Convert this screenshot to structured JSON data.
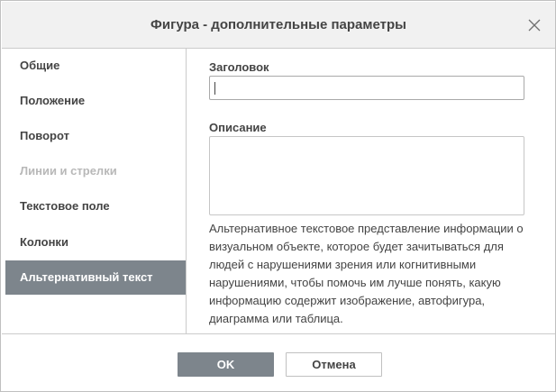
{
  "dialog": {
    "title": "Фигура - дополнительные параметры",
    "close_icon": "close-icon"
  },
  "sidebar": {
    "items": [
      {
        "label": "Общие",
        "state": "normal"
      },
      {
        "label": "Положение",
        "state": "normal"
      },
      {
        "label": "Поворот",
        "state": "normal"
      },
      {
        "label": "Линии и стрелки",
        "state": "disabled"
      },
      {
        "label": "Текстовое поле",
        "state": "normal"
      },
      {
        "label": "Колонки",
        "state": "normal"
      },
      {
        "label": "Альтернативный текст",
        "state": "active"
      }
    ]
  },
  "alt_text": {
    "title_label": "Заголовок",
    "title_value": "",
    "description_label": "Описание",
    "description_value": "",
    "help_text": "Альтернативное текстовое представление информации о визуальном объекте, которое будет зачитываться для людей с нарушениями зрения или когнитивными нарушениями, чтобы помочь им лучше понять, какую информацию содержит изображение, автофигура, диаграмма или таблица."
  },
  "footer": {
    "ok_label": "OK",
    "cancel_label": "Отмена"
  },
  "colors": {
    "active_item_bg": "#7d858c",
    "disabled_text": "#b8b8b8",
    "text": "#444444",
    "titlebar_bg": "#f1f1f1"
  }
}
